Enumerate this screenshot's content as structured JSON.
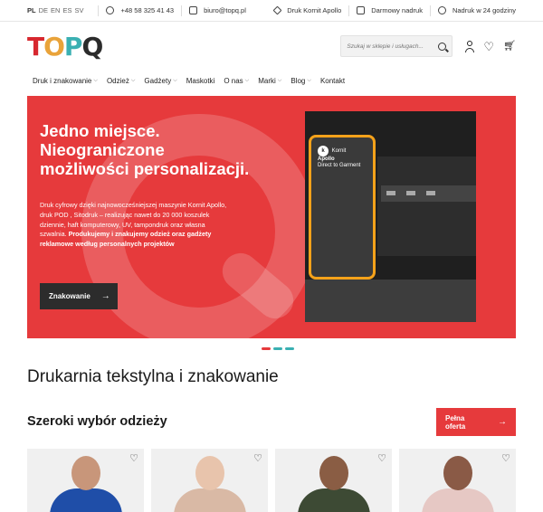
{
  "topbar": {
    "languages": [
      "PL",
      "DE",
      "EN",
      "ES",
      "SV"
    ],
    "phone": "+48 58 325 41 43",
    "email": "biuro@topq.pl",
    "links": [
      "Druk Kornit Apollo",
      "Darmowy nadruk",
      "Nadruk w 24 godziny"
    ]
  },
  "header": {
    "logo": {
      "t": "T",
      "o": "O",
      "p": "P",
      "q": "Q"
    },
    "search_placeholder": "Szukaj w sklepie i usługach..."
  },
  "nav": {
    "items": [
      {
        "label": "Druk i znakowanie",
        "dropdown": "⌵"
      },
      {
        "label": "Odzież",
        "dropdown": "⌵"
      },
      {
        "label": "Gadżety",
        "dropdown": "⌵"
      },
      {
        "label": "Maskotki",
        "dropdown": ""
      },
      {
        "label": "O nas",
        "dropdown": "⌵"
      },
      {
        "label": "Marki",
        "dropdown": "⌵"
      },
      {
        "label": "Blog",
        "dropdown": "⌵"
      },
      {
        "label": "Kontakt",
        "dropdown": ""
      }
    ]
  },
  "hero": {
    "title": "Jedno miejsce. Nieograniczone możliwości personalizacji.",
    "text": "Druk cyfrowy dzięki najnowocześniejszej maszynie Kornit Apollo, druk POD , Sitodruk – realizując nawet do 20 000 koszulek dziennie, haft komputerowy, UV, tampondruk oraz własna szwalnia.",
    "text_bold": "Produkujemy i znakujemy odzież oraz gadżety reklamowe według personalnych projektów",
    "button": "Znakowanie",
    "machine_brand": "Kornit",
    "machine_model": "Apollo",
    "machine_subtitle": "Direct to Garment",
    "colors": {
      "accent": "#e63a3c",
      "machine_frame": "#f5a21a"
    }
  },
  "carousel_dots": [
    "#e63a3c",
    "#3ab0b2",
    "#3ab0b2"
  ],
  "section_title": "Drukarnia tekstylna i znakowanie",
  "products_section": {
    "title": "Szeroki wybór odzieży",
    "cta": "Pełna oferta",
    "cards": [
      {
        "shirt": "#1f4ea8",
        "skin": "#c8967a"
      },
      {
        "shirt": "#d9b9a5",
        "skin": "#e8c4ac"
      },
      {
        "shirt": "#3d4a34",
        "skin": "#8a5d44"
      },
      {
        "shirt": "#e6c8c4",
        "skin": "#8a5a46"
      }
    ]
  }
}
